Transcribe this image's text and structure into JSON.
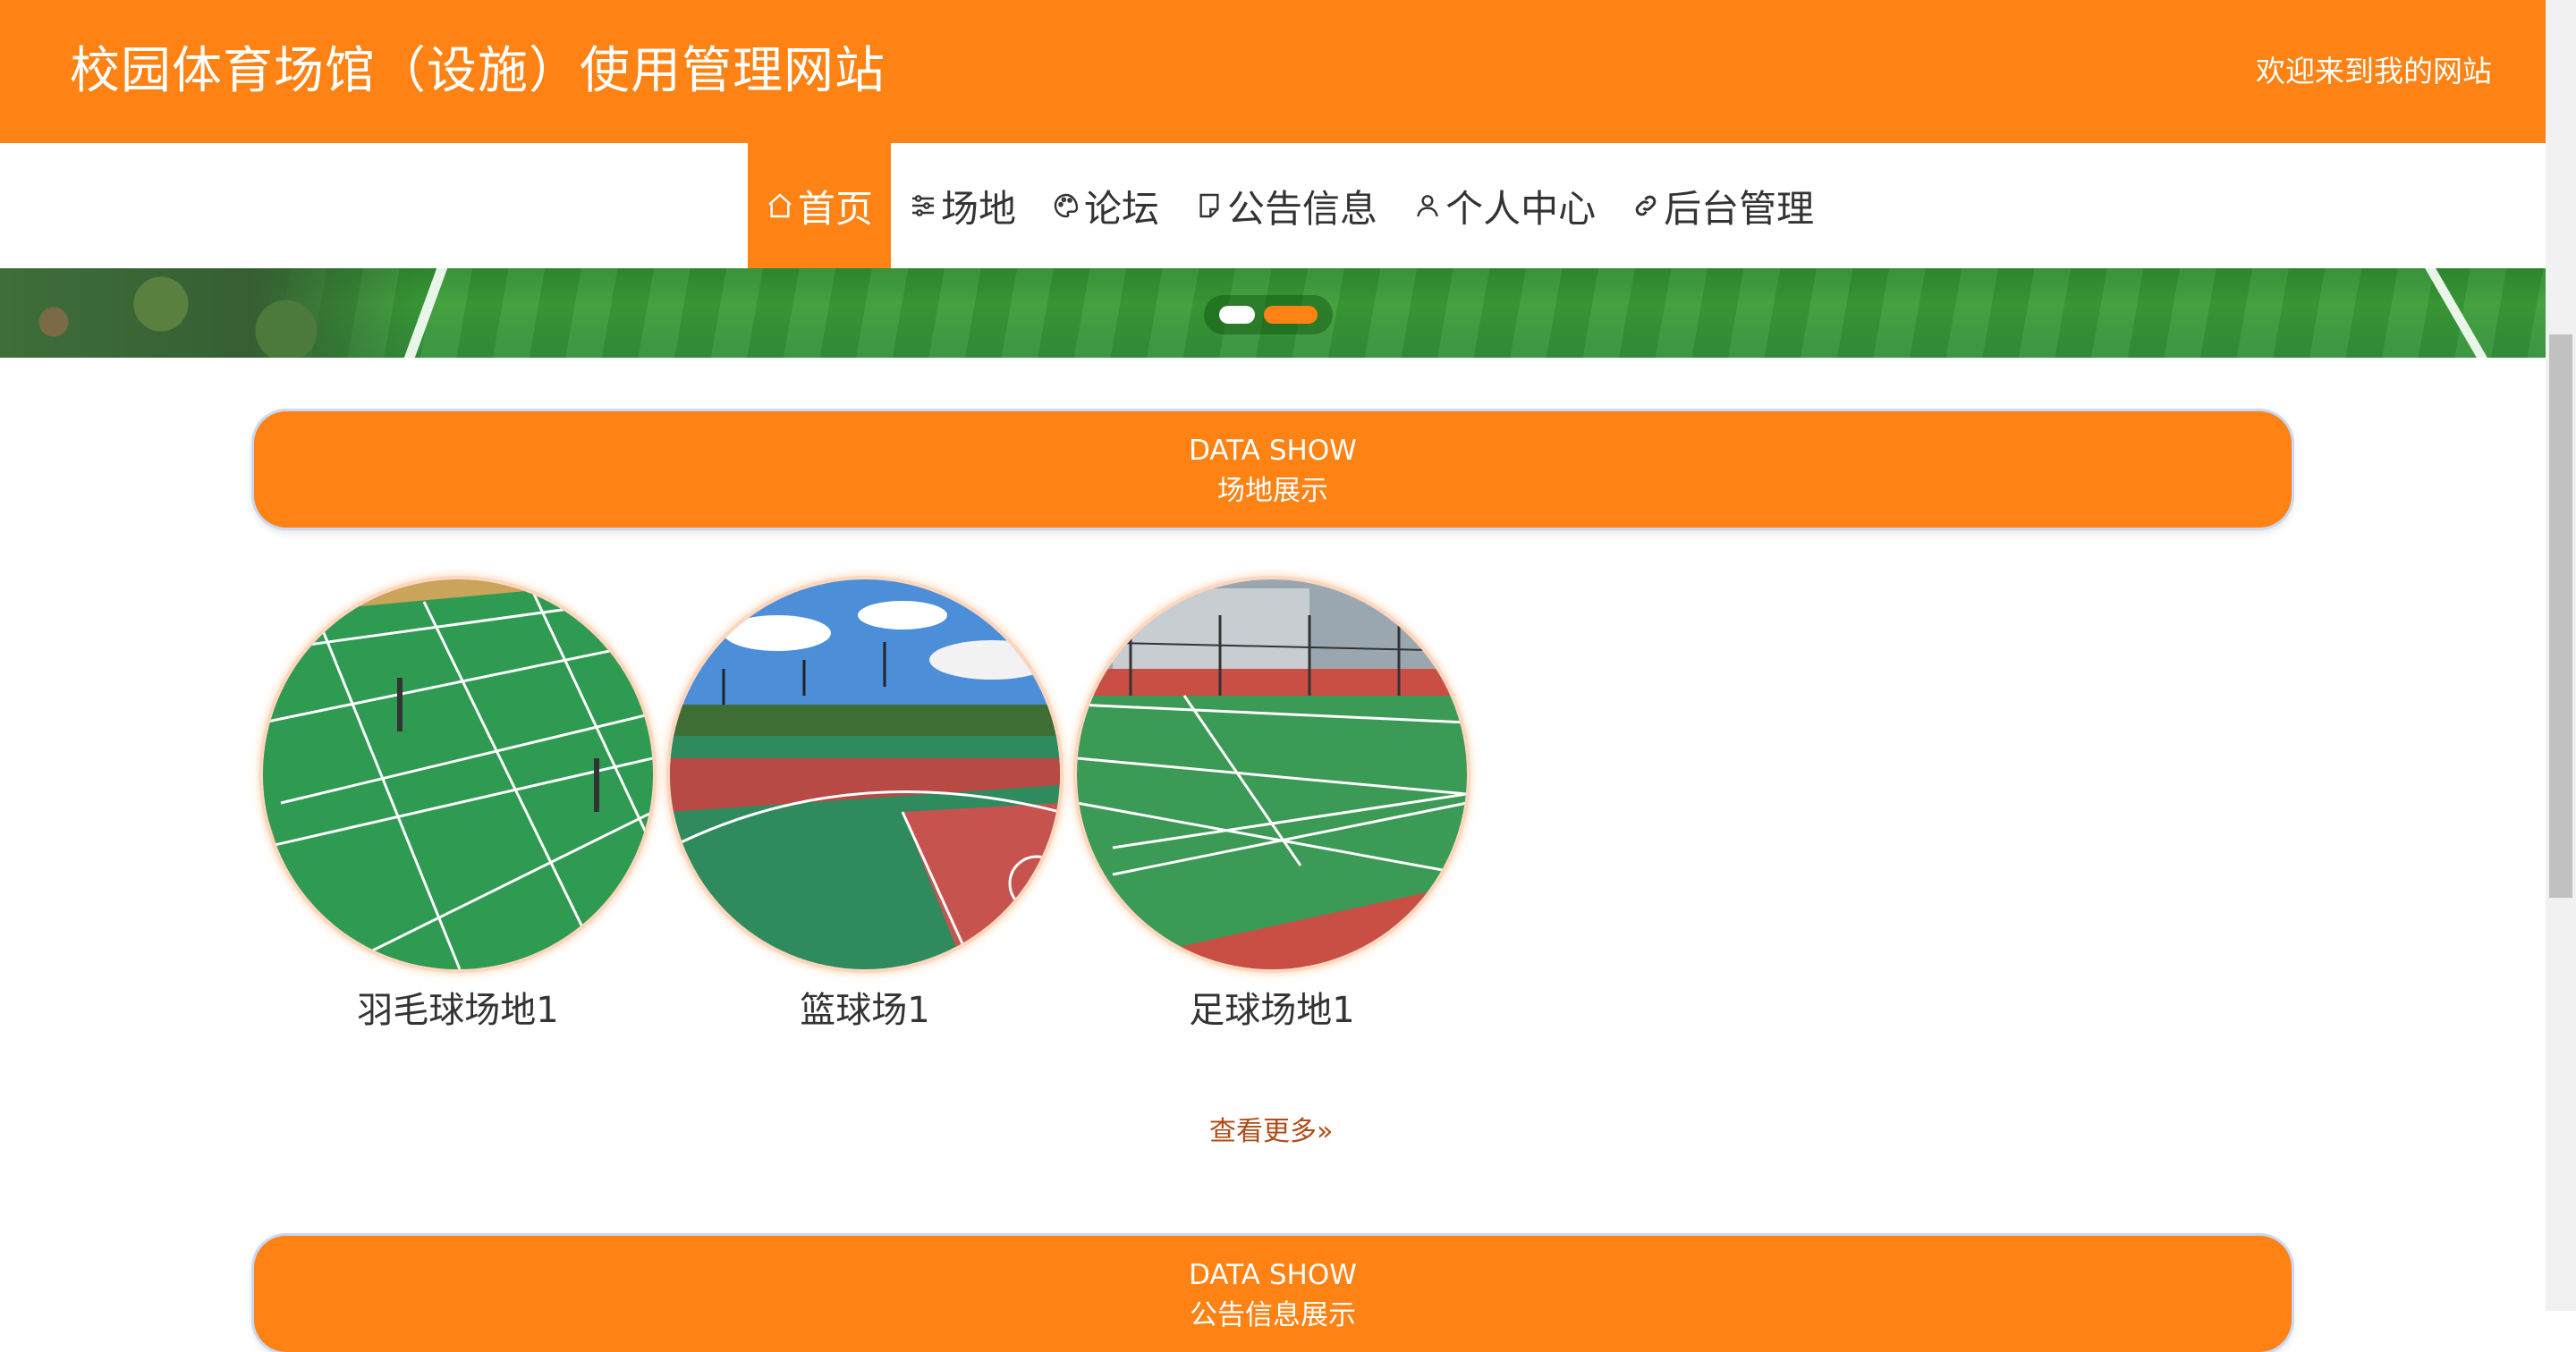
{
  "header": {
    "title": "校园体育场馆（设施）使用管理网站",
    "welcome": "欢迎来到我的网站"
  },
  "nav": {
    "items": [
      {
        "label": "首页",
        "icon": "home-icon"
      },
      {
        "label": "场地",
        "icon": "sliders-icon"
      },
      {
        "label": "论坛",
        "icon": "palette-icon"
      },
      {
        "label": "公告信息",
        "icon": "note-icon"
      },
      {
        "label": "个人中心",
        "icon": "user-icon"
      },
      {
        "label": "后台管理",
        "icon": "link-icon"
      }
    ],
    "active": "首页"
  },
  "banner": {
    "slides": 2,
    "active_slide": 2
  },
  "sections": [
    {
      "en": "DATA SHOW",
      "cn": "场地展示"
    },
    {
      "en": "DATA SHOW",
      "cn": "公告信息展示"
    }
  ],
  "venues": [
    {
      "name": "羽毛球场地1"
    },
    {
      "name": "篮球场1"
    },
    {
      "name": "足球场地1"
    }
  ],
  "more_label": "查看更多",
  "colors": {
    "accent": "#fe8214",
    "more_link": "#b04c16"
  }
}
